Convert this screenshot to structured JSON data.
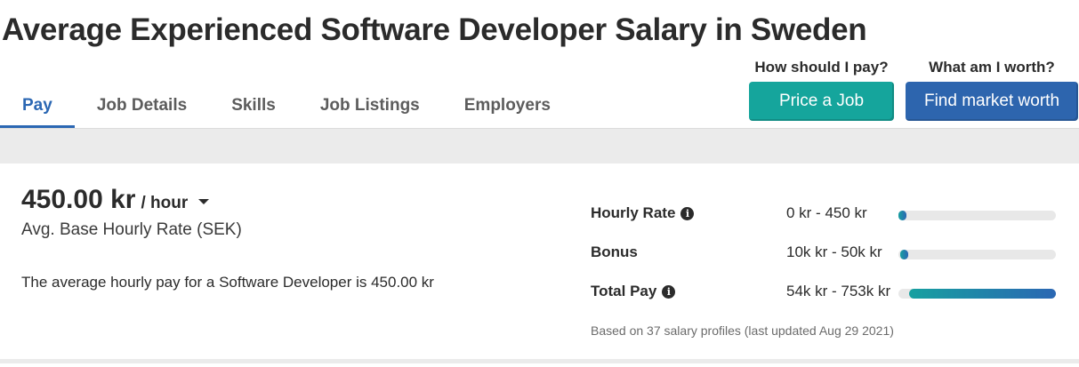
{
  "page": {
    "title": "Average Experienced Software Developer Salary in Sweden"
  },
  "tabs": [
    {
      "label": "Pay",
      "active": true
    },
    {
      "label": "Job Details",
      "active": false
    },
    {
      "label": "Skills",
      "active": false
    },
    {
      "label": "Job Listings",
      "active": false
    },
    {
      "label": "Employers",
      "active": false
    }
  ],
  "cta": {
    "price": {
      "question": "How should I pay?",
      "button": "Price a Job",
      "color": "#15a59c"
    },
    "worth": {
      "question": "What am I worth?",
      "button": "Find market worth",
      "color": "#2d65ae"
    }
  },
  "summary": {
    "value": "450.00 kr",
    "unit": "/ hour",
    "caption": "Avg. Base Hourly Rate (SEK)",
    "text": "The average hourly pay for a Software Developer is 450.00 kr"
  },
  "metrics": [
    {
      "label": "Hourly Rate",
      "info": true,
      "range": "0 kr - 450 kr",
      "bar_start": 0.0,
      "bar_end": 0.05
    },
    {
      "label": "Bonus",
      "info": false,
      "range": "10k kr - 50k kr",
      "bar_start": 0.01,
      "bar_end": 0.06
    },
    {
      "label": "Total Pay",
      "info": true,
      "range": "54k kr - 753k kr",
      "bar_start": 0.07,
      "bar_end": 1.0
    }
  ],
  "footnote": "Based on 37 salary profiles (last updated Aug 29 2021)",
  "colors": {
    "accent": "#2b67b3",
    "teal": "#15a59c",
    "band": "#ebebeb"
  }
}
